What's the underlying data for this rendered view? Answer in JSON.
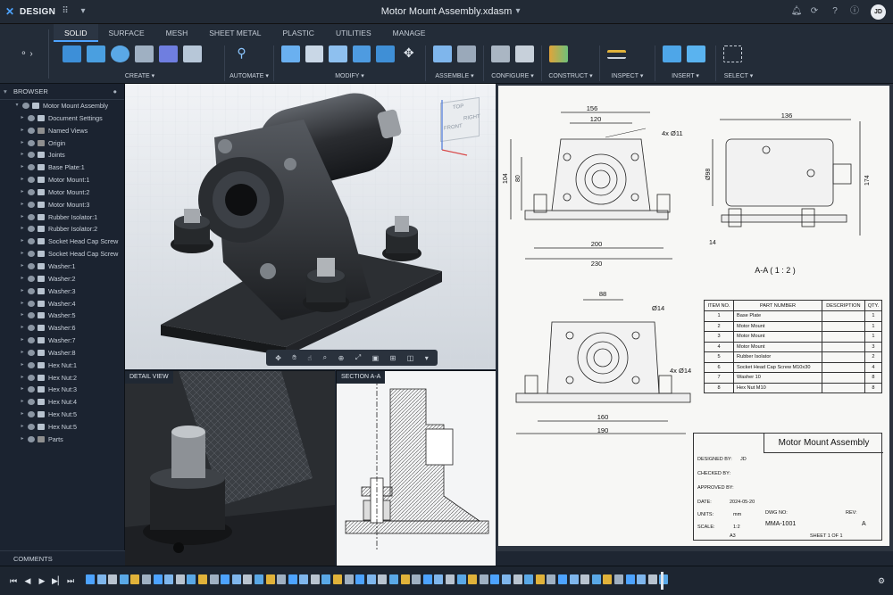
{
  "titlebar": {
    "app_name": "DESIGN",
    "doc_title": "Motor Mount Assembly.xdasm",
    "user_initials": "JD"
  },
  "ribbon": {
    "tabs": [
      "SOLID",
      "SURFACE",
      "MESH",
      "SHEET METAL",
      "PLASTIC",
      "UTILITIES",
      "MANAGE"
    ],
    "active_tab": "SOLID",
    "groups": [
      {
        "label": "CREATE ▾"
      },
      {
        "label": "AUTOMATE ▾"
      },
      {
        "label": "MODIFY ▾"
      },
      {
        "label": "ASSEMBLE ▾"
      },
      {
        "label": "CONFIGURE ▾"
      },
      {
        "label": "CONSTRUCT ▾"
      },
      {
        "label": "INSPECT ▾"
      },
      {
        "label": "INSERT ▾"
      },
      {
        "label": "SELECT ▾"
      }
    ]
  },
  "browser": {
    "title": "BROWSER",
    "items": [
      "Motor Mount Assembly",
      "Document Settings",
      "Named Views",
      "Origin",
      "Joints",
      "Base Plate:1",
      "Motor Mount:1",
      "Motor Mount:2",
      "Motor Mount:3",
      "Rubber Isolator:1",
      "Rubber Isolator:2",
      "Socket Head Cap Screw",
      "Socket Head Cap Screw",
      "Washer:1",
      "Washer:2",
      "Washer:3",
      "Washer:4",
      "Washer:5",
      "Washer:6",
      "Washer:7",
      "Washer:8",
      "Hex Nut:1",
      "Hex Nut:2",
      "Hex Nut:3",
      "Hex Nut:4",
      "Hex Nut:5",
      "Hex Nut:5",
      "Parts"
    ],
    "comments_label": "COMMENTS"
  },
  "viewcube": {
    "top": "TOP",
    "front": "FRONT",
    "right": "RIGHT"
  },
  "views": {
    "detail_label": "DETAIL VIEW",
    "section_label": "SECTION A-A"
  },
  "drawing": {
    "dims_top": {
      "d156": "156",
      "d120": "120",
      "d200": "200",
      "d230": "230",
      "d104": "104",
      "d80": "80",
      "hole": "4x Ø11",
      "d136": "136",
      "d98": "Ø98",
      "d174": "174",
      "d14": "14"
    },
    "section_title": "A-A  ( 1 : 2 )",
    "dims_bottom": {
      "d88": "88",
      "d14": "Ø14",
      "hole": "4x Ø14",
      "d160": "160",
      "d190": "190"
    },
    "bom": {
      "headers": [
        "ITEM NO.",
        "PART NUMBER",
        "DESCRIPTION",
        "QTY."
      ],
      "rows": [
        [
          "1",
          "Base Plate",
          "",
          "1"
        ],
        [
          "2",
          "Motor Mount",
          "",
          "1"
        ],
        [
          "3",
          "Motor Mount",
          "",
          "1"
        ],
        [
          "4",
          "Motor Mount",
          "",
          "3"
        ],
        [
          "5",
          "Rubber Isolator",
          "",
          "2"
        ],
        [
          "6",
          "Socket Head Cap Screw M10x30",
          "",
          "4"
        ],
        [
          "7",
          "Washer 10",
          "",
          "8"
        ],
        [
          "8",
          "Hex Nut M10",
          "",
          "8"
        ]
      ]
    },
    "title_block": {
      "title": "Motor Mount Assembly",
      "designed_by_label": "DESIGNED BY:",
      "designed_by": "JD",
      "checked_by_label": "CHECKED BY:",
      "approved_by_label": "APPROVED BY:",
      "date_label": "DATE:",
      "date": "2024-05-20",
      "units_label": "UNITS:",
      "units": "mm",
      "scale_label": "SCALE:",
      "scale": "1:2",
      "dwg_no_label": "DWG NO:",
      "dwg_no": "MMA-1001",
      "rev_label": "REV:",
      "rev": "A",
      "size": "A3",
      "sheet": "SHEET 1 OF 1"
    }
  },
  "colors": {
    "accent": "#4da3ff",
    "panel": "#1b2330",
    "ribbon": "#232c38"
  }
}
